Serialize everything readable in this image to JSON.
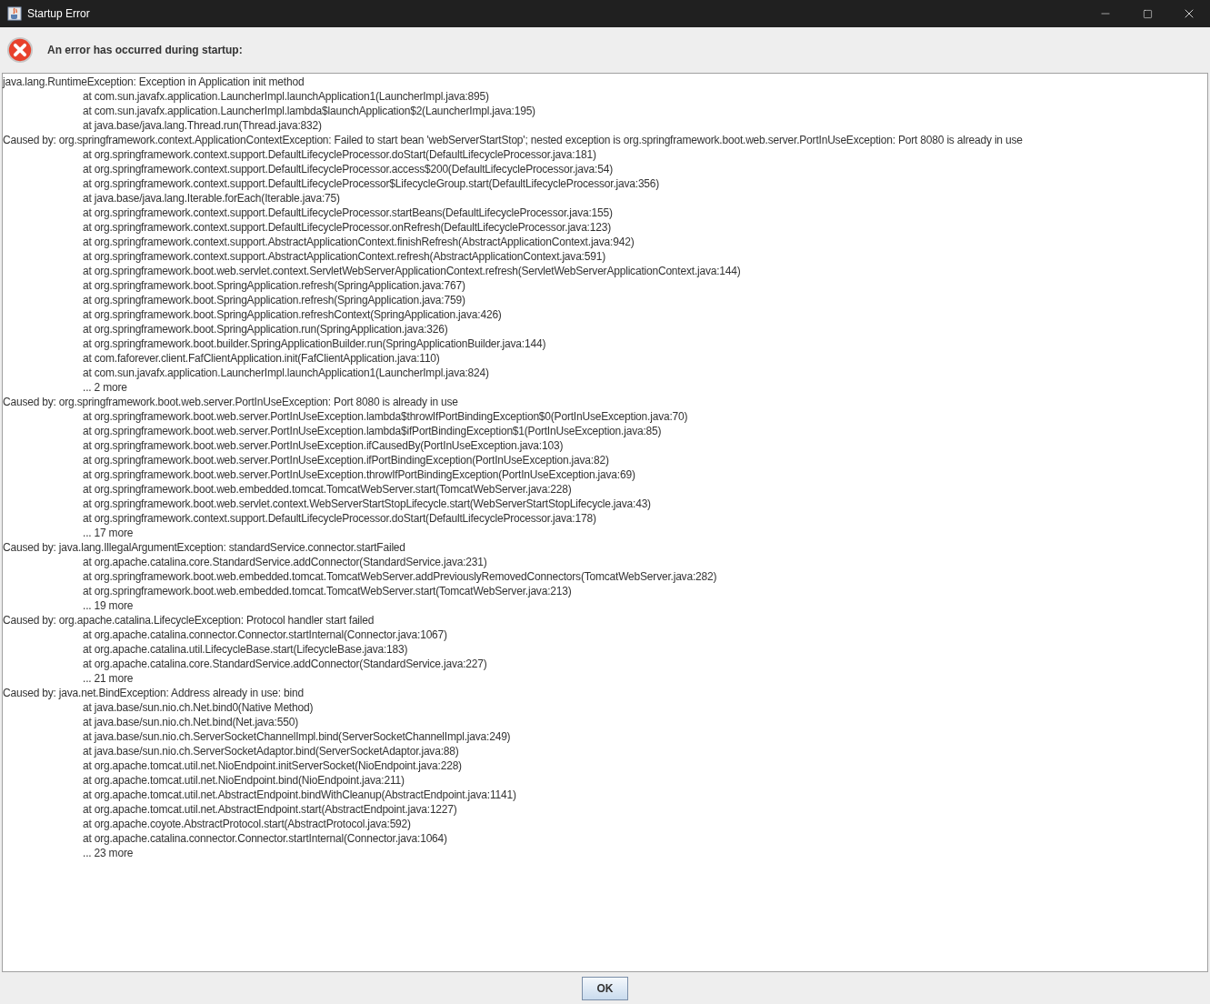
{
  "window": {
    "title": "Startup Error"
  },
  "message": "An error has occurred during startup:",
  "trace": [
    {
      "kind": "cause",
      "text": "java.lang.RuntimeException: Exception in Application init method"
    },
    {
      "kind": "frame",
      "text": "at com.sun.javafx.application.LauncherImpl.launchApplication1(LauncherImpl.java:895)"
    },
    {
      "kind": "frame",
      "text": "at com.sun.javafx.application.LauncherImpl.lambda$launchApplication$2(LauncherImpl.java:195)"
    },
    {
      "kind": "frame",
      "text": "at java.base/java.lang.Thread.run(Thread.java:832)"
    },
    {
      "kind": "cause",
      "text": "Caused by: org.springframework.context.ApplicationContextException: Failed to start bean 'webServerStartStop'; nested exception is org.springframework.boot.web.server.PortInUseException: Port 8080 is already in use"
    },
    {
      "kind": "frame",
      "text": "at org.springframework.context.support.DefaultLifecycleProcessor.doStart(DefaultLifecycleProcessor.java:181)"
    },
    {
      "kind": "frame",
      "text": "at org.springframework.context.support.DefaultLifecycleProcessor.access$200(DefaultLifecycleProcessor.java:54)"
    },
    {
      "kind": "frame",
      "text": "at org.springframework.context.support.DefaultLifecycleProcessor$LifecycleGroup.start(DefaultLifecycleProcessor.java:356)"
    },
    {
      "kind": "frame",
      "text": "at java.base/java.lang.Iterable.forEach(Iterable.java:75)"
    },
    {
      "kind": "frame",
      "text": "at org.springframework.context.support.DefaultLifecycleProcessor.startBeans(DefaultLifecycleProcessor.java:155)"
    },
    {
      "kind": "frame",
      "text": "at org.springframework.context.support.DefaultLifecycleProcessor.onRefresh(DefaultLifecycleProcessor.java:123)"
    },
    {
      "kind": "frame",
      "text": "at org.springframework.context.support.AbstractApplicationContext.finishRefresh(AbstractApplicationContext.java:942)"
    },
    {
      "kind": "frame",
      "text": "at org.springframework.context.support.AbstractApplicationContext.refresh(AbstractApplicationContext.java:591)"
    },
    {
      "kind": "frame",
      "text": "at org.springframework.boot.web.servlet.context.ServletWebServerApplicationContext.refresh(ServletWebServerApplicationContext.java:144)"
    },
    {
      "kind": "frame",
      "text": "at org.springframework.boot.SpringApplication.refresh(SpringApplication.java:767)"
    },
    {
      "kind": "frame",
      "text": "at org.springframework.boot.SpringApplication.refresh(SpringApplication.java:759)"
    },
    {
      "kind": "frame",
      "text": "at org.springframework.boot.SpringApplication.refreshContext(SpringApplication.java:426)"
    },
    {
      "kind": "frame",
      "text": "at org.springframework.boot.SpringApplication.run(SpringApplication.java:326)"
    },
    {
      "kind": "frame",
      "text": "at org.springframework.boot.builder.SpringApplicationBuilder.run(SpringApplicationBuilder.java:144)"
    },
    {
      "kind": "frame",
      "text": "at com.faforever.client.FafClientApplication.init(FafClientApplication.java:110)"
    },
    {
      "kind": "frame",
      "text": "at com.sun.javafx.application.LauncherImpl.launchApplication1(LauncherImpl.java:824)"
    },
    {
      "kind": "frame",
      "text": "... 2 more"
    },
    {
      "kind": "cause",
      "text": "Caused by: org.springframework.boot.web.server.PortInUseException: Port 8080 is already in use"
    },
    {
      "kind": "frame",
      "text": "at org.springframework.boot.web.server.PortInUseException.lambda$throwIfPortBindingException$0(PortInUseException.java:70)"
    },
    {
      "kind": "frame",
      "text": "at org.springframework.boot.web.server.PortInUseException.lambda$ifPortBindingException$1(PortInUseException.java:85)"
    },
    {
      "kind": "frame",
      "text": "at org.springframework.boot.web.server.PortInUseException.ifCausedBy(PortInUseException.java:103)"
    },
    {
      "kind": "frame",
      "text": "at org.springframework.boot.web.server.PortInUseException.ifPortBindingException(PortInUseException.java:82)"
    },
    {
      "kind": "frame",
      "text": "at org.springframework.boot.web.server.PortInUseException.throwIfPortBindingException(PortInUseException.java:69)"
    },
    {
      "kind": "frame",
      "text": "at org.springframework.boot.web.embedded.tomcat.TomcatWebServer.start(TomcatWebServer.java:228)"
    },
    {
      "kind": "frame",
      "text": "at org.springframework.boot.web.servlet.context.WebServerStartStopLifecycle.start(WebServerStartStopLifecycle.java:43)"
    },
    {
      "kind": "frame",
      "text": "at org.springframework.context.support.DefaultLifecycleProcessor.doStart(DefaultLifecycleProcessor.java:178)"
    },
    {
      "kind": "frame",
      "text": "... 17 more"
    },
    {
      "kind": "cause",
      "text": "Caused by: java.lang.IllegalArgumentException: standardService.connector.startFailed"
    },
    {
      "kind": "frame",
      "text": "at org.apache.catalina.core.StandardService.addConnector(StandardService.java:231)"
    },
    {
      "kind": "frame",
      "text": "at org.springframework.boot.web.embedded.tomcat.TomcatWebServer.addPreviouslyRemovedConnectors(TomcatWebServer.java:282)"
    },
    {
      "kind": "frame",
      "text": "at org.springframework.boot.web.embedded.tomcat.TomcatWebServer.start(TomcatWebServer.java:213)"
    },
    {
      "kind": "frame",
      "text": "... 19 more"
    },
    {
      "kind": "cause",
      "text": "Caused by: org.apache.catalina.LifecycleException: Protocol handler start failed"
    },
    {
      "kind": "frame",
      "text": "at org.apache.catalina.connector.Connector.startInternal(Connector.java:1067)"
    },
    {
      "kind": "frame",
      "text": "at org.apache.catalina.util.LifecycleBase.start(LifecycleBase.java:183)"
    },
    {
      "kind": "frame",
      "text": "at org.apache.catalina.core.StandardService.addConnector(StandardService.java:227)"
    },
    {
      "kind": "frame",
      "text": "... 21 more"
    },
    {
      "kind": "cause",
      "text": "Caused by: java.net.BindException: Address already in use: bind"
    },
    {
      "kind": "frame",
      "text": "at java.base/sun.nio.ch.Net.bind0(Native Method)"
    },
    {
      "kind": "frame",
      "text": "at java.base/sun.nio.ch.Net.bind(Net.java:550)"
    },
    {
      "kind": "frame",
      "text": "at java.base/sun.nio.ch.ServerSocketChannelImpl.bind(ServerSocketChannelImpl.java:249)"
    },
    {
      "kind": "frame",
      "text": "at java.base/sun.nio.ch.ServerSocketAdaptor.bind(ServerSocketAdaptor.java:88)"
    },
    {
      "kind": "frame",
      "text": "at org.apache.tomcat.util.net.NioEndpoint.initServerSocket(NioEndpoint.java:228)"
    },
    {
      "kind": "frame",
      "text": "at org.apache.tomcat.util.net.NioEndpoint.bind(NioEndpoint.java:211)"
    },
    {
      "kind": "frame",
      "text": "at org.apache.tomcat.util.net.AbstractEndpoint.bindWithCleanup(AbstractEndpoint.java:1141)"
    },
    {
      "kind": "frame",
      "text": "at org.apache.tomcat.util.net.AbstractEndpoint.start(AbstractEndpoint.java:1227)"
    },
    {
      "kind": "frame",
      "text": "at org.apache.coyote.AbstractProtocol.start(AbstractProtocol.java:592)"
    },
    {
      "kind": "frame",
      "text": "at org.apache.catalina.connector.Connector.startInternal(Connector.java:1064)"
    },
    {
      "kind": "frame",
      "text": "... 23 more"
    }
  ],
  "buttons": [
    "OK"
  ]
}
